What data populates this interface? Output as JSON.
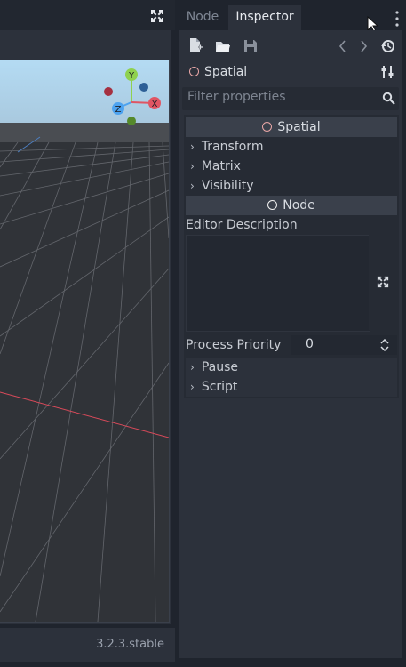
{
  "viewport": {
    "version": "3.2.3.stable"
  },
  "dock": {
    "tabs": [
      {
        "label": "Node"
      },
      {
        "label": "Inspector"
      }
    ],
    "object_name": "Spatial",
    "filter_placeholder": "Filter properties",
    "sections": {
      "spatial_header": "Spatial",
      "spatial_items": [
        "Transform",
        "Matrix",
        "Visibility"
      ],
      "node_header": "Node",
      "editor_description_label": "Editor Description",
      "process_priority_label": "Process Priority",
      "process_priority_value": "0",
      "node_items": [
        "Pause",
        "Script"
      ]
    }
  },
  "colors": {
    "accent_circle": "#e8a6a6",
    "x_axis": "#e05563",
    "y_axis": "#8fd14f",
    "z_axis": "#4da3f0"
  }
}
